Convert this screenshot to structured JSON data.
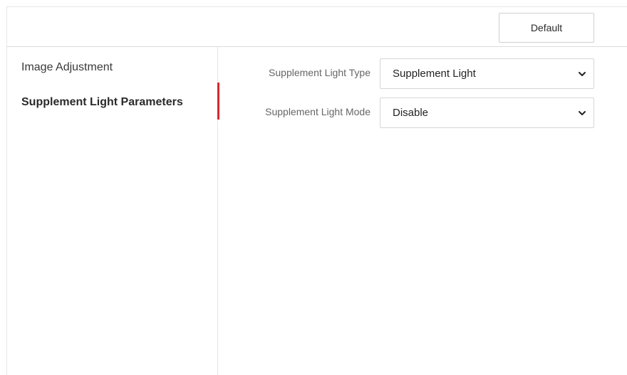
{
  "toolbar": {
    "default_label": "Default"
  },
  "sidebar": {
    "items": [
      {
        "label": "Image Adjustment",
        "active": false
      },
      {
        "label": "Supplement Light Parameters",
        "active": true
      }
    ]
  },
  "form": {
    "supplement_light_type": {
      "label": "Supplement Light Type",
      "value": "Supplement Light",
      "icon": "chevron-down-icon"
    },
    "supplement_light_mode": {
      "label": "Supplement Light Mode",
      "value": "Disable",
      "icon": "chevron-down-icon"
    }
  },
  "colors": {
    "active_marker": "#d7282f",
    "border": "#d6d6d6",
    "label_text": "#666666"
  }
}
